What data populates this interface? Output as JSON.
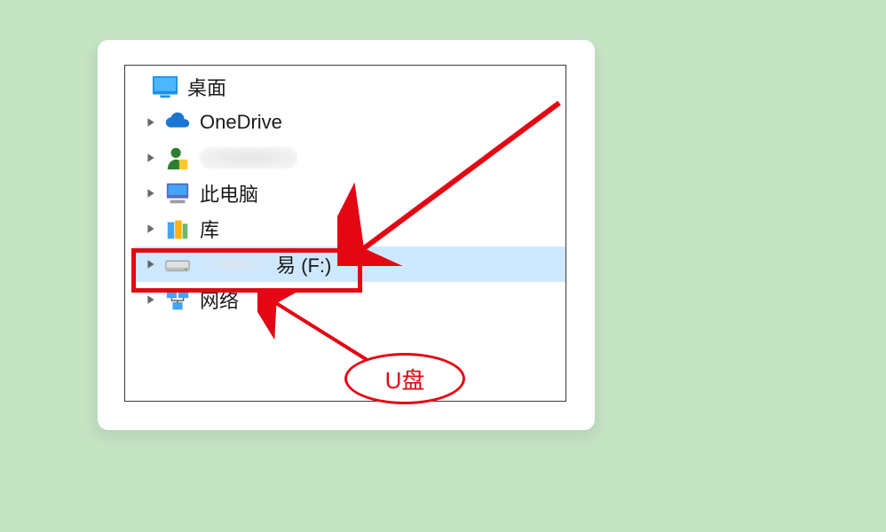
{
  "tree": {
    "root": {
      "label": "桌面"
    },
    "items": [
      {
        "label": "OneDrive"
      },
      {
        "label": ""
      },
      {
        "label": "此电脑"
      },
      {
        "label": "库"
      },
      {
        "label_suffix": "易 (F:)"
      },
      {
        "label": "网络"
      }
    ]
  },
  "annotation": {
    "label": "U盘"
  }
}
